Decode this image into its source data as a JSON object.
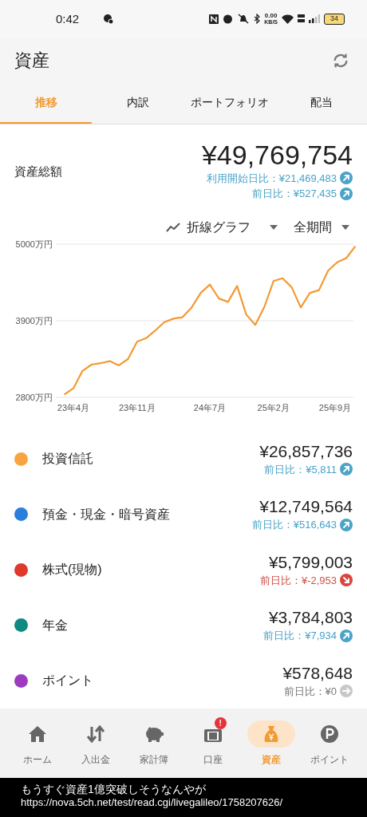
{
  "status_bar": {
    "time": "0:42",
    "network_speed": "0.00",
    "network_unit": "KB/S",
    "battery": "34"
  },
  "app_bar": {
    "title": "資産"
  },
  "tabs": [
    {
      "label": "推移",
      "selected": true
    },
    {
      "label": "内訳",
      "selected": false
    },
    {
      "label": "ポートフォリオ",
      "selected": false
    },
    {
      "label": "配当",
      "selected": false
    }
  ],
  "total": {
    "label": "資産総額",
    "amount": "¥49,769,754",
    "changes": [
      {
        "text": "利用開始日比：¥21,469,483",
        "kind": "up"
      },
      {
        "text": "前日比：¥527,435",
        "kind": "up"
      }
    ]
  },
  "chart_controls": {
    "chart_type": "折線グラフ",
    "period": "全期間"
  },
  "chart_data": {
    "type": "line",
    "categories": [
      null,
      "23年4月",
      null,
      null,
      null,
      null,
      null,
      null,
      "23年11月",
      null,
      null,
      null,
      null,
      null,
      null,
      null,
      "24年7月",
      null,
      null,
      null,
      null,
      null,
      null,
      "25年2月",
      null,
      null,
      null,
      null,
      null,
      null,
      "25年9月",
      null,
      null
    ],
    "series": [
      {
        "color": "#f39a32",
        "values": [
          2840,
          2930,
          3180,
          3270,
          3290,
          3320,
          3260,
          3350,
          3600,
          3650,
          3760,
          3880,
          3930,
          3950,
          4090,
          4300,
          4420,
          4220,
          4170,
          4400,
          3990,
          3840,
          4100,
          4470,
          4510,
          4380,
          4090,
          4300,
          4340,
          4620,
          4740,
          4800,
          4970
        ]
      }
    ],
    "ylim": [
      2800,
      5000
    ],
    "yticks": [
      {
        "value": 2800,
        "label": "2800万円"
      },
      {
        "value": 3900,
        "label": "3900万円"
      },
      {
        "value": 5000,
        "label": "5000万円"
      }
    ]
  },
  "categories": [
    {
      "name": "投資信託",
      "color": "#f9a443",
      "amount": "¥26,857,736",
      "change": "前日比：¥5,811",
      "kind": "up"
    },
    {
      "name": "預金・現金・暗号資産",
      "color": "#2a7fdd",
      "amount": "¥12,749,564",
      "change": "前日比：¥516,643",
      "kind": "up"
    },
    {
      "name": "株式(現物)",
      "color": "#e0392b",
      "amount": "¥5,799,003",
      "change": "前日比：¥-2,953",
      "kind": "down"
    },
    {
      "name": "年金",
      "color": "#0e8a80",
      "amount": "¥3,784,803",
      "change": "前日比：¥7,934",
      "kind": "up"
    },
    {
      "name": "ポイント",
      "color": "#9c3bbf",
      "amount": "¥578,648",
      "change": "前日比：¥0",
      "kind": "flat"
    }
  ],
  "bottom_nav": [
    {
      "label": "ホーム",
      "kind": "home",
      "selected": false
    },
    {
      "label": "入出金",
      "kind": "transfer",
      "selected": false
    },
    {
      "label": "家計簿",
      "kind": "budget",
      "selected": false
    },
    {
      "label": "口座",
      "kind": "account",
      "selected": false,
      "badge": "!"
    },
    {
      "label": "資産",
      "kind": "assets",
      "selected": true
    },
    {
      "label": "ポイント",
      "kind": "points",
      "selected": false
    }
  ],
  "caption": {
    "text": "もうすぐ資産1億突破しそうなんやが",
    "url": "https://nova.5ch.net/test/read.cgi/livegalileo/1758207626/"
  }
}
